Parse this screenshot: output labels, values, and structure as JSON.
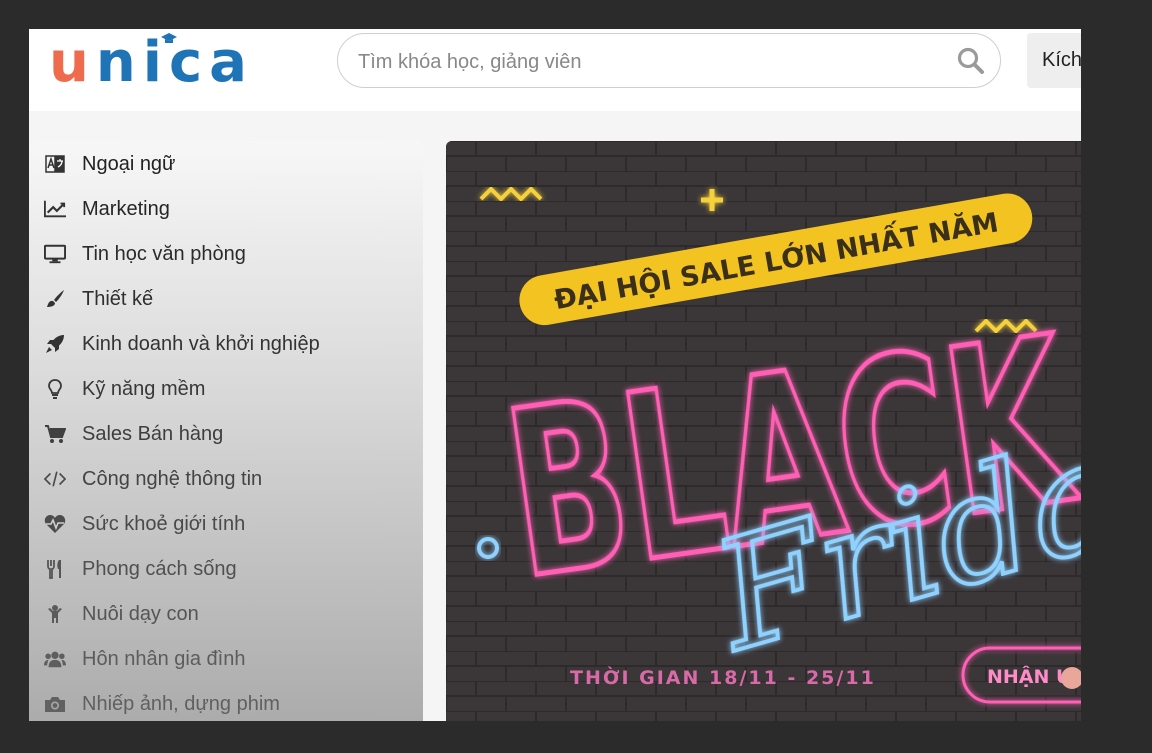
{
  "logo": {
    "u": "u",
    "rest": "nica"
  },
  "search": {
    "placeholder": "Tìm khóa học, giảng viên"
  },
  "header": {
    "activate_label": "Kích"
  },
  "sidebar": {
    "items": [
      {
        "label": "Ngoại ngữ",
        "icon": "language-icon"
      },
      {
        "label": "Marketing",
        "icon": "line-chart-icon"
      },
      {
        "label": "Tin học văn phòng",
        "icon": "desktop-icon"
      },
      {
        "label": "Thiết kế",
        "icon": "paint-brush-icon"
      },
      {
        "label": "Kinh doanh và khởi nghiệp",
        "icon": "rocket-icon"
      },
      {
        "label": "Kỹ năng mềm",
        "icon": "lightbulb-icon"
      },
      {
        "label": "Sales Bán hàng",
        "icon": "shopping-cart-icon"
      },
      {
        "label": "Công nghệ thông tin",
        "icon": "code-icon"
      },
      {
        "label": "Sức khoẻ giới tính",
        "icon": "heartbeat-icon"
      },
      {
        "label": "Phong cách sống",
        "icon": "cutlery-icon"
      },
      {
        "label": "Nuôi dạy con",
        "icon": "child-icon"
      },
      {
        "label": "Hôn nhân gia đình",
        "icon": "users-icon"
      },
      {
        "label": "Nhiếp ảnh, dựng phim",
        "icon": "camera-icon"
      }
    ]
  },
  "banner": {
    "headline": "ĐẠI HỘI SALE LỚN NHẤT NĂM",
    "title": "BLACK",
    "subtitle": "Friday",
    "period": "THỜI GIAN 18/11 - 25/11",
    "cta": "NHẬN Ư"
  },
  "colors": {
    "brand_blue": "#1f73b7",
    "brand_orange": "#ee6b4d",
    "neon_pink": "#ff5fb4",
    "neon_blue": "#8fd2ff",
    "banner_yellow": "#f3c322"
  }
}
